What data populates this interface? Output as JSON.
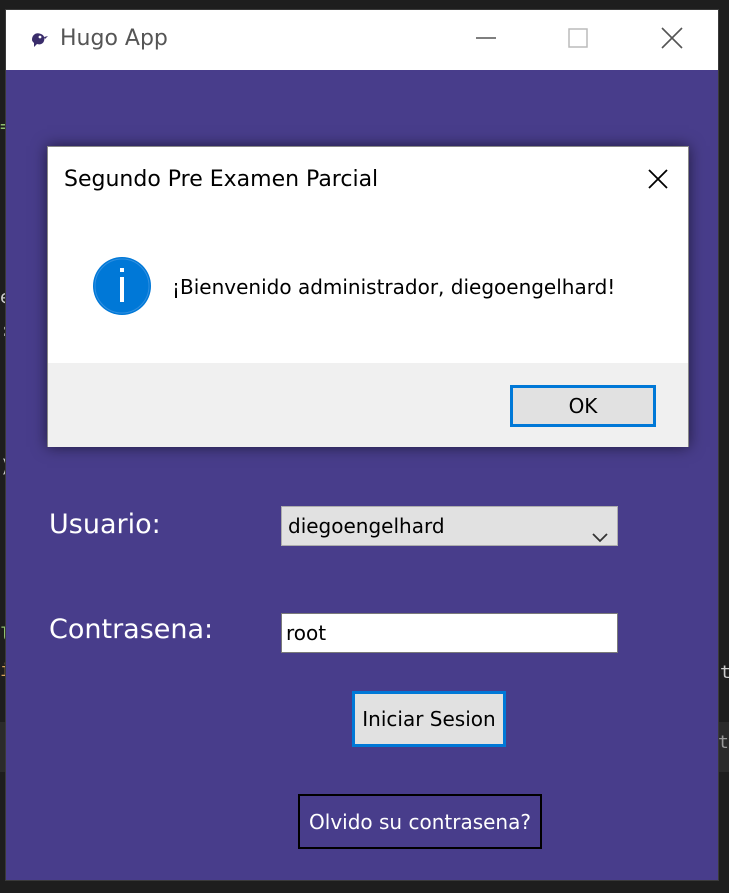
{
  "window": {
    "title": "Hugo App",
    "accent_color": "#483D8B"
  },
  "form": {
    "usuario_label": "Usuario:",
    "usuario_value": "diegoengelhard",
    "contrasena_label": "Contrasena:",
    "contrasena_value": "root",
    "login_button": "Iniciar Sesion",
    "forgot_button": "Olvido su contrasena?"
  },
  "dialog": {
    "title": "Segundo Pre Examen Parcial",
    "message": "¡Bienvenido administrador, diegoengelhard!",
    "icon": "info-icon",
    "ok_button": "OK"
  },
  "icons": {
    "app": "bird-icon",
    "minimize": "minimize-icon",
    "maximize": "maximize-icon",
    "close": "close-icon",
    "dropdown": "chevron-down-icon"
  }
}
